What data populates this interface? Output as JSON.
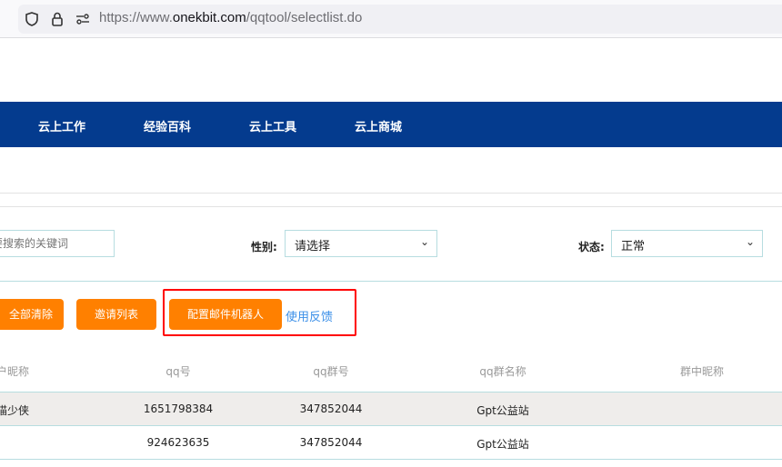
{
  "browser": {
    "url_domain_prefix": "https://www.",
    "url_domain": "onekbit.com",
    "url_path": "/qqtool/selectlist.do"
  },
  "nav": {
    "items": [
      "云上工作",
      "经验百科",
      "云上工具",
      "云上商城"
    ],
    "bg_color": "#043b8e"
  },
  "filters": {
    "keyword_placeholder": "要搜索的关键词",
    "gender_label": "性别:",
    "gender_value": "请选择",
    "status_label": "状态:",
    "status_value": "正常"
  },
  "actions": {
    "clear_all": "全部清除",
    "invite_list": "邀请列表",
    "config_mail_bot": "配置邮件机器人",
    "feedback": "使用反馈",
    "accent": "#ff8000",
    "highlight": "#ff0000"
  },
  "table": {
    "headers": [
      "户昵称",
      "qq号",
      "qq群号",
      "qq群名称",
      "群中昵称"
    ],
    "rows": [
      [
        "猫少侠",
        "1651798384",
        "347852044",
        "Gpt公益站",
        ""
      ],
      [
        "",
        "924623635",
        "347852044",
        "Gpt公益站",
        ""
      ]
    ]
  }
}
